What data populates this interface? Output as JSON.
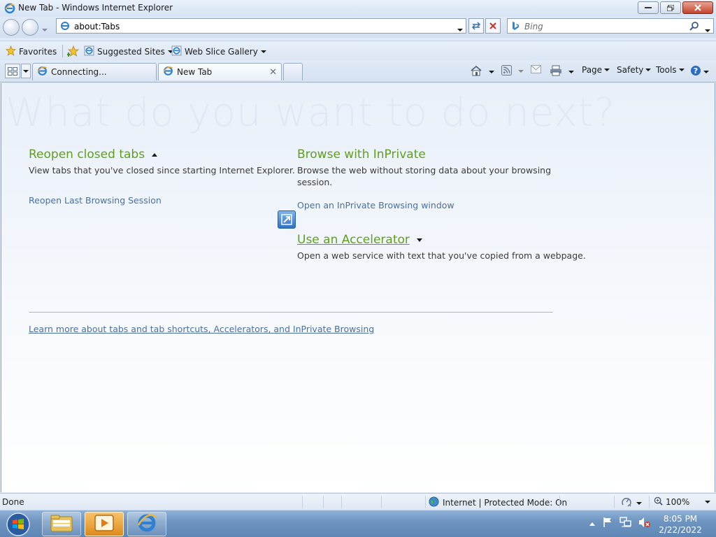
{
  "window": {
    "title": "New Tab - Windows Internet Explorer"
  },
  "address": {
    "url": "about:Tabs"
  },
  "search": {
    "placeholder": "Bing"
  },
  "favorites_bar": {
    "favorites_label": "Favorites",
    "suggested_sites_label": "Suggested Sites",
    "web_slice_gallery_label": "Web Slice Gallery"
  },
  "tabs": [
    {
      "label": "Connecting..."
    },
    {
      "label": "New Tab"
    }
  ],
  "command_bar": {
    "page_label": "Page",
    "safety_label": "Safety",
    "tools_label": "Tools"
  },
  "content": {
    "hero": "What do you want to do next?",
    "reopen": {
      "heading": "Reopen closed tabs",
      "description": "View tabs that you've closed since starting Internet Explorer.",
      "link": "Reopen Last Browsing Session"
    },
    "inprivate": {
      "heading": "Browse with InPrivate",
      "description_line1": "Browse the web without storing data about your browsing",
      "description_line2": "session.",
      "link": "Open an InPrivate Browsing window"
    },
    "accelerator": {
      "heading": "Use an Accelerator",
      "description": "Open a web service with text that you've copied from a webpage."
    },
    "learn_more": "Learn more about tabs and tab shortcuts, Accelerators, and InPrivate Browsing"
  },
  "status_bar": {
    "status": "Done",
    "zone": "Internet | Protected Mode: On",
    "zoom": "100%"
  },
  "taskbar": {
    "time": "8:05 PM",
    "date": "2/22/2022"
  }
}
